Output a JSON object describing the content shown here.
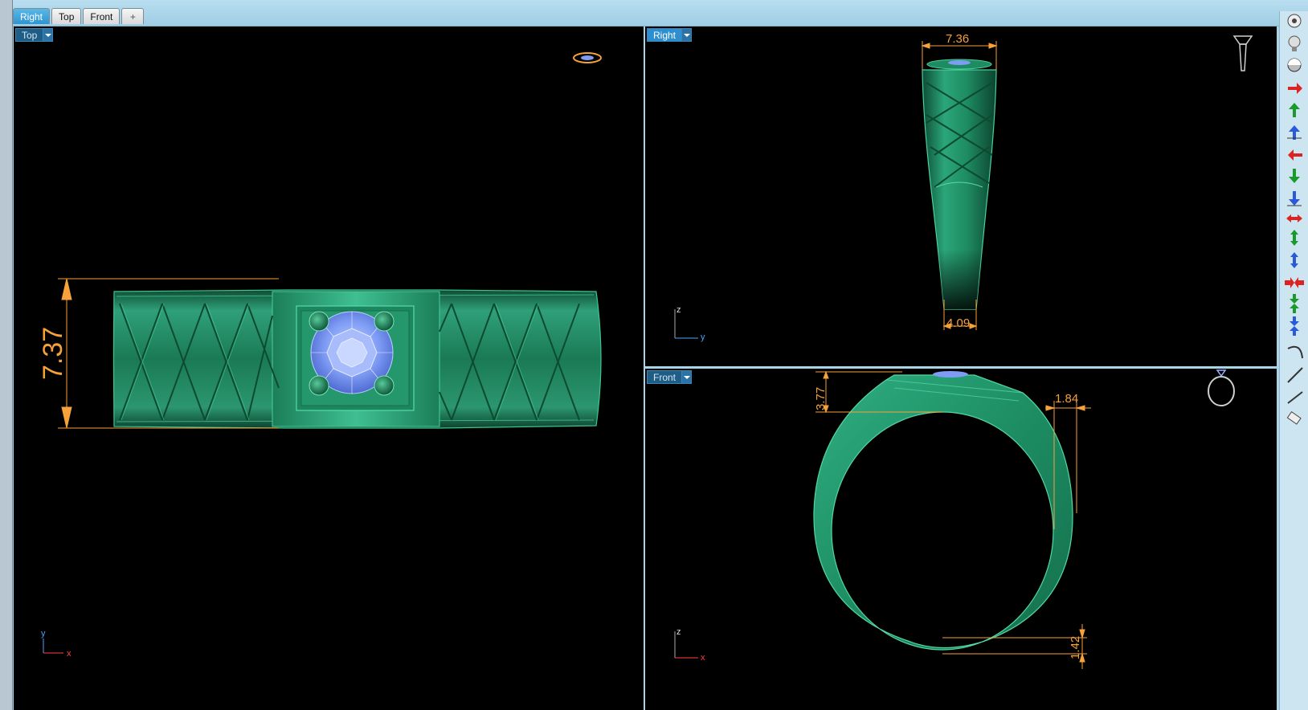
{
  "window_tabs": [
    "Right",
    "Top",
    "Front"
  ],
  "active_tab": "Right",
  "add_tab_glyph": "+",
  "viewports": {
    "top": {
      "label": "Top",
      "dimensions": {
        "height": "7.37"
      },
      "axes": {
        "vertical": "y",
        "horizontal": "x"
      }
    },
    "right": {
      "label": "Right",
      "dimensions": {
        "top_width": "7.36",
        "bottom_width": "4.09"
      },
      "axes": {
        "vertical": "z",
        "horizontal": "y"
      }
    },
    "front": {
      "label": "Front",
      "dimensions": {
        "top_height": "3.77",
        "shoulder_width": "1.84",
        "bottom_thickness": "1.42"
      },
      "axes": {
        "vertical": "z",
        "horizontal": "x"
      }
    }
  },
  "right_toolbar": [
    "render-icon",
    "light-bulb-icon",
    "shaded-sphere-icon",
    "arrow-right-red-icon",
    "arrow-up-green-icon",
    "arrow-up-blue-icon",
    "arrow-left-red-icon",
    "arrow-down-green-icon",
    "arrow-down-blue-icon",
    "arrows-horizontal-red-icon",
    "arrows-vertical-green-icon",
    "arrows-vertical-blue-icon",
    "arrows-inward-red-icon",
    "arrows-inward-green-icon",
    "arrows-inward-blue-icon",
    "arc-tool-icon",
    "line-tool-icon",
    "line-tool-2-icon",
    "eraser-icon"
  ],
  "colors": {
    "ring_green": "#1f8a5f",
    "gem_blue": "#7f9cf5",
    "dimension": "#f6a13a",
    "viewport_bg": "#000000",
    "frame": "#a9d3e6"
  }
}
